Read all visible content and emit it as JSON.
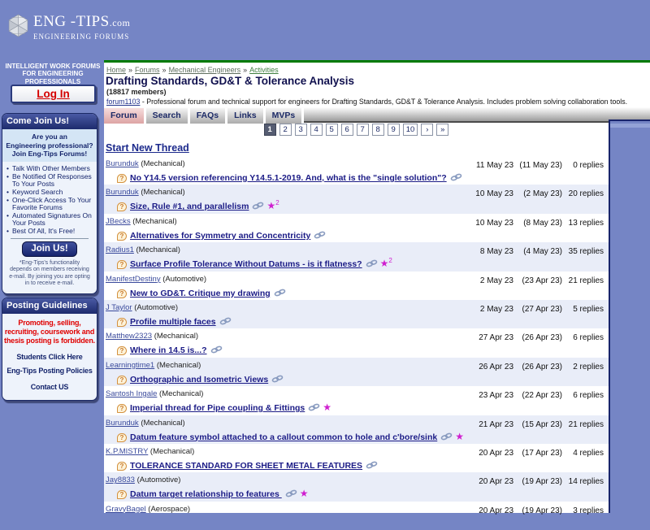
{
  "logo": {
    "name": "ENG -TIPS",
    "tld": ".com",
    "subtitle": "ENGINEERING FORUMS"
  },
  "sidebar": {
    "tagline": "INTELLIGENT WORK FORUMS\nFOR ENGINEERING\nPROFESSIONALS",
    "login_label": "Log In",
    "join_box": {
      "title": "Come Join Us!",
      "intro": "Are you an\nEngineering professional?\nJoin Eng-Tips Forums!",
      "benefits": [
        "Talk With Other Members",
        "Be Notified Of Responses To Your Posts",
        "Keyword Search",
        "One-Click Access To Your Favorite Forums",
        "Automated Signatures On Your Posts",
        "Best Of All, It's Free!"
      ],
      "join_label": "Join Us!",
      "fine_print": "*Eng-Tips's functionality depends on members receiving e-mail. By joining you are opting in to receive e-mail."
    },
    "guidelines_box": {
      "title": "Posting Guidelines",
      "forbidden": "Promoting, selling, recruiting, coursework and thesis posting is forbidden.",
      "links": [
        "Students Click Here",
        "Eng-Tips Posting Policies",
        "Contact US"
      ]
    }
  },
  "breadcrumb": {
    "items": [
      "Home",
      "Forums",
      "Mechanical Engineers",
      "Activities"
    ],
    "separator": "»"
  },
  "header": {
    "title": "Drafting Standards, GD&T & Tolerance Analysis",
    "members": "(18817 members)",
    "forum_link": "forum1103",
    "description": " - Professional forum and technical support for engineers for Drafting Standards, GD&T & Tolerance Analysis. Includes problem solving collaboration tools."
  },
  "tabs": {
    "items": [
      "Forum",
      "Search",
      "FAQs",
      "Links",
      "MVPs"
    ],
    "active_index": 0
  },
  "pagination": {
    "items": [
      "1",
      "2",
      "3",
      "4",
      "5",
      "6",
      "7",
      "8",
      "9",
      "10",
      "›",
      "»"
    ],
    "active_index": 0
  },
  "threads": {
    "start_new_label": "Start New Thread",
    "replies_label": "replies",
    "rows": [
      {
        "author": "Burunduk",
        "category": "Mechanical",
        "title": "No Y14.5 version referencing Y14.5.1-2019. And, what is the \"single solution\"?",
        "has_link": true,
        "stars": 0,
        "last_post": "11 May 23",
        "first_post": "11 May 23",
        "replies": 0
      },
      {
        "author": "Burunduk",
        "category": "Mechanical",
        "title": "Size, Rule #1, and parallelism",
        "has_link": true,
        "stars": 2,
        "last_post": "10 May 23",
        "first_post": "2 May 23",
        "replies": 20
      },
      {
        "author": "JBecks",
        "category": "Mechanical",
        "title": "Alternatives for Symmetry and Concentricity",
        "has_link": true,
        "stars": 0,
        "last_post": "10 May 23",
        "first_post": "8 May 23",
        "replies": 13
      },
      {
        "author": "Radius1",
        "category": "Mechanical",
        "title": "Surface Profile Tolerance Without Datums - is it flatness?",
        "has_link": true,
        "stars": 2,
        "last_post": "8 May 23",
        "first_post": "4 May 23",
        "replies": 35
      },
      {
        "author": "ManifestDestiny",
        "category": "Automotive",
        "title": "New to GD&T. Critique my drawing",
        "has_link": true,
        "stars": 0,
        "last_post": "2 May 23",
        "first_post": "23 Apr 23",
        "replies": 21
      },
      {
        "author": "J Taylor",
        "category": "Automotive",
        "title": "Profile multiple faces",
        "has_link": true,
        "stars": 0,
        "last_post": "2 May 23",
        "first_post": "27 Apr 23",
        "replies": 5
      },
      {
        "author": "Matthew2323",
        "category": "Mechanical",
        "title": "Where in 14.5 is...?",
        "has_link": true,
        "stars": 0,
        "last_post": "27 Apr 23",
        "first_post": "26 Apr 23",
        "replies": 6
      },
      {
        "author": "Learningtime1",
        "category": "Mechanical",
        "title": "Orthographic and Isometric Views",
        "has_link": true,
        "stars": 0,
        "last_post": "26 Apr 23",
        "first_post": "26 Apr 23",
        "replies": 2
      },
      {
        "author": "Santosh Ingale",
        "category": "Mechanical",
        "title": "Imperial thread for Pipe coupling & Fittings",
        "has_link": true,
        "stars": 1,
        "last_post": "23 Apr 23",
        "first_post": "22 Apr 23",
        "replies": 6
      },
      {
        "author": "Burunduk",
        "category": "Mechanical",
        "title": "Datum feature symbol attached to a callout common to hole and c'bore/sink",
        "has_link": true,
        "stars": 1,
        "last_post": "21 Apr 23",
        "first_post": "15 Apr 23",
        "replies": 21
      },
      {
        "author": "K.P.MISTRY",
        "category": "Mechanical",
        "title": "TOLERANCE STANDARD FOR SHEET METAL FEATURES",
        "has_link": true,
        "stars": 0,
        "last_post": "20 Apr 23",
        "first_post": "17 Apr 23",
        "replies": 4
      },
      {
        "author": "Jay8833",
        "category": "Automotive",
        "title": "Datum target relationship to features ",
        "has_link": true,
        "stars": 1,
        "last_post": "20 Apr 23",
        "first_post": "19 Apr 23",
        "replies": 14
      },
      {
        "author": "GravyBagel",
        "category": "Aerospace",
        "title": "",
        "has_link": false,
        "stars": 0,
        "last_post": "20 Apr 23",
        "first_post": "19 Apr 23",
        "replies": 3
      }
    ]
  }
}
